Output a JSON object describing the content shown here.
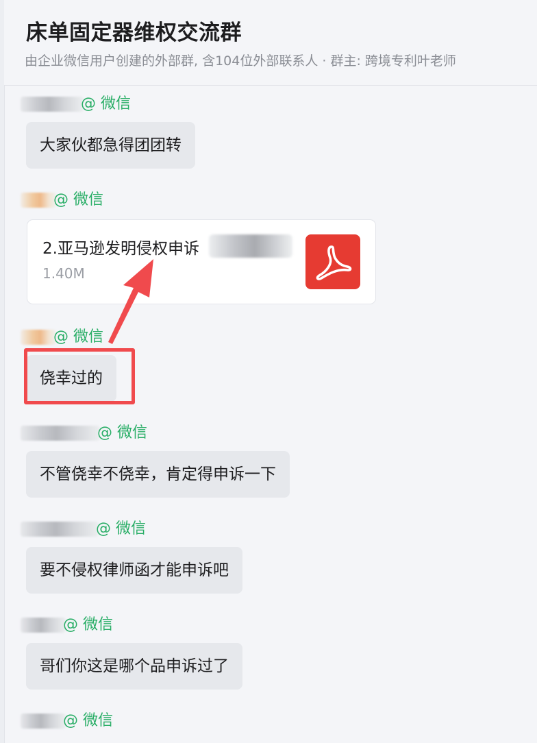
{
  "header": {
    "title": "床单固定器维权交流群",
    "subtitle": "由企业微信用户创建的外部群, 含104位外部联系人 · 群主: 跨境专利叶老师"
  },
  "messages": [
    {
      "sender_tag": "@ 微信",
      "text": "大家伙都急得团团转"
    },
    {
      "sender_tag": "@ 微信",
      "file": {
        "name": "2.亚马逊发明侵权申诉",
        "size": "1.40M",
        "icon": "pdf-icon",
        "icon_color": "#e63b32"
      }
    },
    {
      "sender_tag": "@ 微信",
      "text": "侥幸过的",
      "highlighted": true
    },
    {
      "sender_tag": "@ 微信",
      "text": "不管侥幸不侥幸，肯定得申诉一下"
    },
    {
      "sender_tag": "@ 微信",
      "text": "要不侵权律师函才能申诉吧"
    },
    {
      "sender_tag": "@ 微信",
      "text": "哥们你这是哪个品申诉过了"
    },
    {
      "sender_tag": "@ 微信"
    }
  ],
  "colors": {
    "sender_tag": "#2aae67",
    "bubble": "#e6e8ec",
    "annotation": "#f04a4d"
  }
}
